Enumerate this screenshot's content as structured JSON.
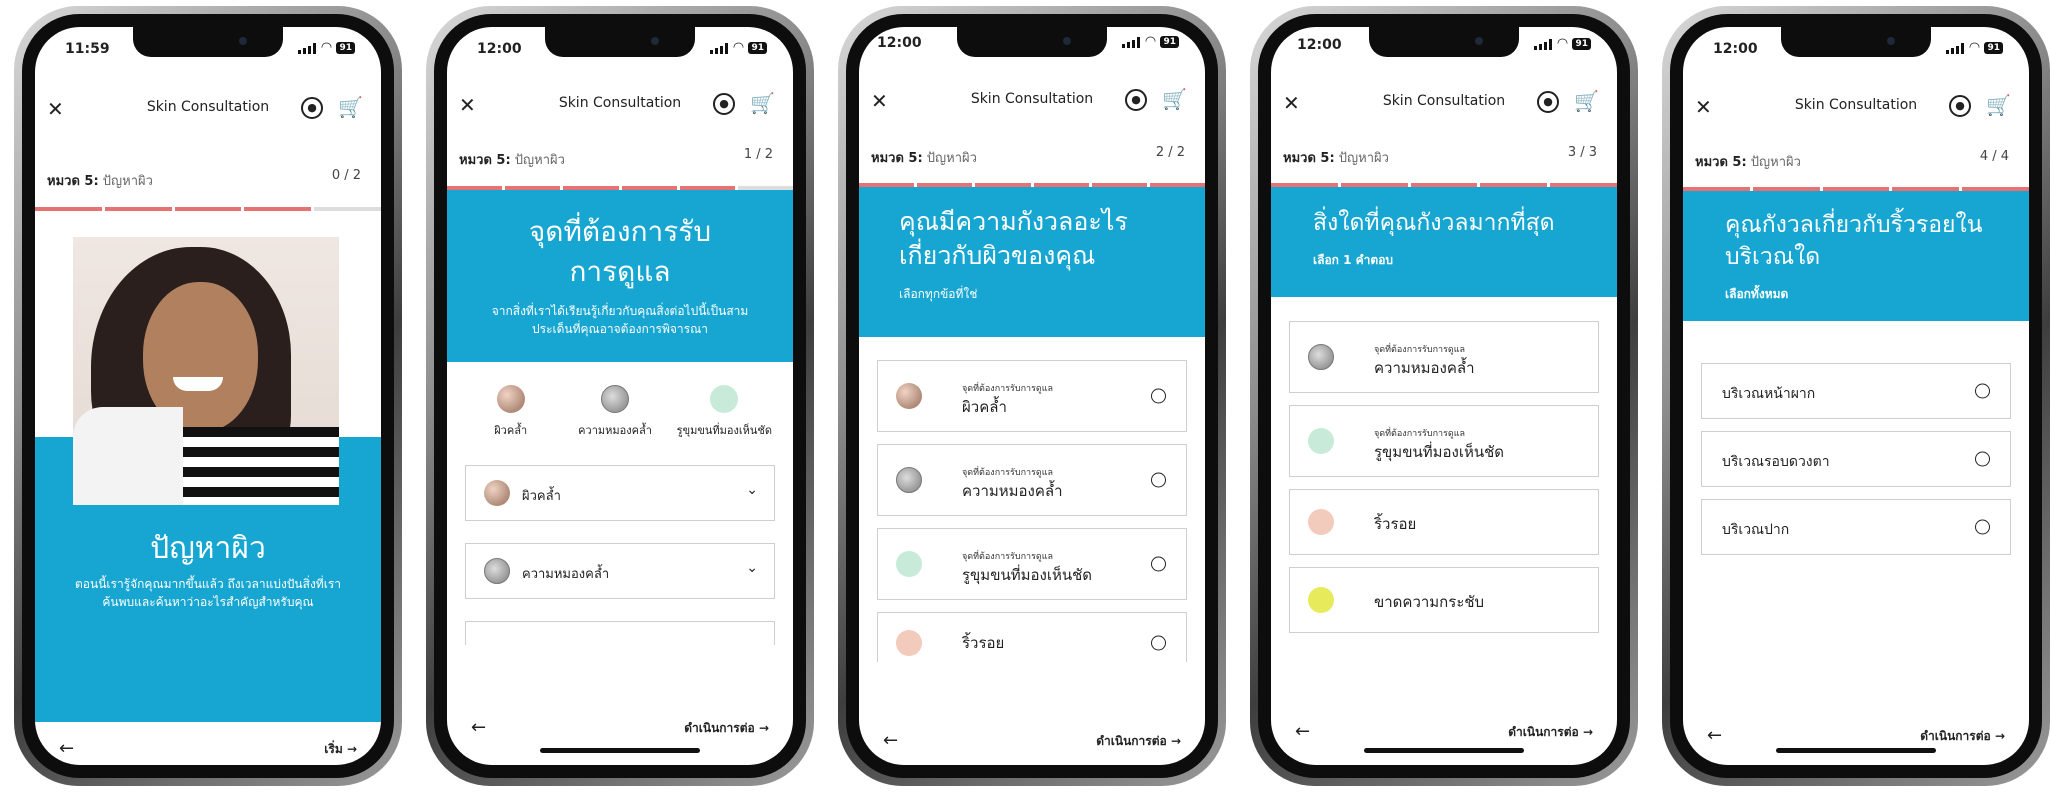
{
  "screens": [
    {
      "time": "11:59",
      "battery": "91",
      "header_title": "Skin Consultation",
      "section_label": "หมวด 5:",
      "section_name": "ปัญหาผิว",
      "count": "0 / 2",
      "hero_title": "ปัญหาผิว",
      "hero_text": "ตอนนี้เรารู้จักคุณมากขึ้นแล้ว ถึงเวลาแบ่งปันสิ่งที่เราค้นพบและค้นหาว่าอะไรสำคัญสำหรับคุณ",
      "next_label": "เริ่ม"
    },
    {
      "time": "12:00",
      "battery": "91",
      "header_title": "Skin Consultation",
      "section_label": "หมวด 5:",
      "section_name": "ปัญหาผิว",
      "count": "1 / 2",
      "title": "จุดที่ต้องการรับการดูแล",
      "subtitle": "จากสิ่งที่เราได้เรียนรู้เกี่ยวกับคุณสิ่งต่อไปนี้เป็นสามประเด็นที่คุณอาจต้องการพิจารณา",
      "concerns": [
        "ผิวคล้ำ",
        "ความหมองคล้ำ",
        "รูขุมขนที่มองเห็นชัด"
      ],
      "accordions": [
        "ผิวคล้ำ",
        "ความหมองคล้ำ"
      ],
      "next_label": "ดำเนินการต่อ"
    },
    {
      "time": "12:00",
      "battery": "91",
      "header_title": "Skin Consultation",
      "section_label": "หมวด 5:",
      "section_name": "ปัญหาผิว",
      "count": "2 / 2",
      "title": "คุณมีความกังวลอะไรเกี่ยวกับผิวของคุณ",
      "instruction": "เลือกทุกข้อที่ใช่",
      "options": [
        {
          "tag": "จุดที่ต้องการรับการดูแล",
          "label": "ผิวคล้ำ"
        },
        {
          "tag": "จุดที่ต้องการรับการดูแล",
          "label": "ความหมองคล้ำ"
        },
        {
          "tag": "จุดที่ต้องการรับการดูแล",
          "label": "รูขุมขนที่มองเห็นชัด"
        },
        {
          "tag": "",
          "label": "ริ้วรอย"
        }
      ],
      "next_label": "ดำเนินการต่อ"
    },
    {
      "time": "12:00",
      "battery": "91",
      "header_title": "Skin Consultation",
      "section_label": "หมวด 5:",
      "section_name": "ปัญหาผิว",
      "count": "3 / 3",
      "title": "สิ่งใดที่คุณกังวลมากที่สุด",
      "instruction": "เลือก 1 คำตอบ",
      "options": [
        {
          "tag": "จุดที่ต้องการรับการดูแล",
          "label": "ความหมองคล้ำ"
        },
        {
          "tag": "จุดที่ต้องการรับการดูแล",
          "label": "รูขุมขนที่มองเห็นชัด"
        },
        {
          "tag": "",
          "label": "ริ้วรอย"
        },
        {
          "tag": "",
          "label": "ขาดความกระชับ"
        }
      ],
      "next_label": "ดำเนินการต่อ"
    },
    {
      "time": "12:00",
      "battery": "91",
      "header_title": "Skin Consultation",
      "section_label": "หมวด 5:",
      "section_name": "ปัญหาผิว",
      "count": "4 / 4",
      "title": "คุณกังวลเกี่ยวกับริ้วรอยในบริเวณใด",
      "instruction": "เลือกทั้งหมด",
      "options": [
        {
          "label": "บริเวณหน้าผาก"
        },
        {
          "label": "บริเวณรอบดวงตา"
        },
        {
          "label": "บริเวณปาก"
        }
      ],
      "next_label": "ดำเนินการต่อ"
    }
  ],
  "colors": {
    "accent": "#16a6d1",
    "progress": "#e57373"
  },
  "icons": {
    "close": "close-icon",
    "account": "account-icon",
    "cart": "cart-icon",
    "back": "arrow-left-icon",
    "next": "arrow-right-icon"
  }
}
